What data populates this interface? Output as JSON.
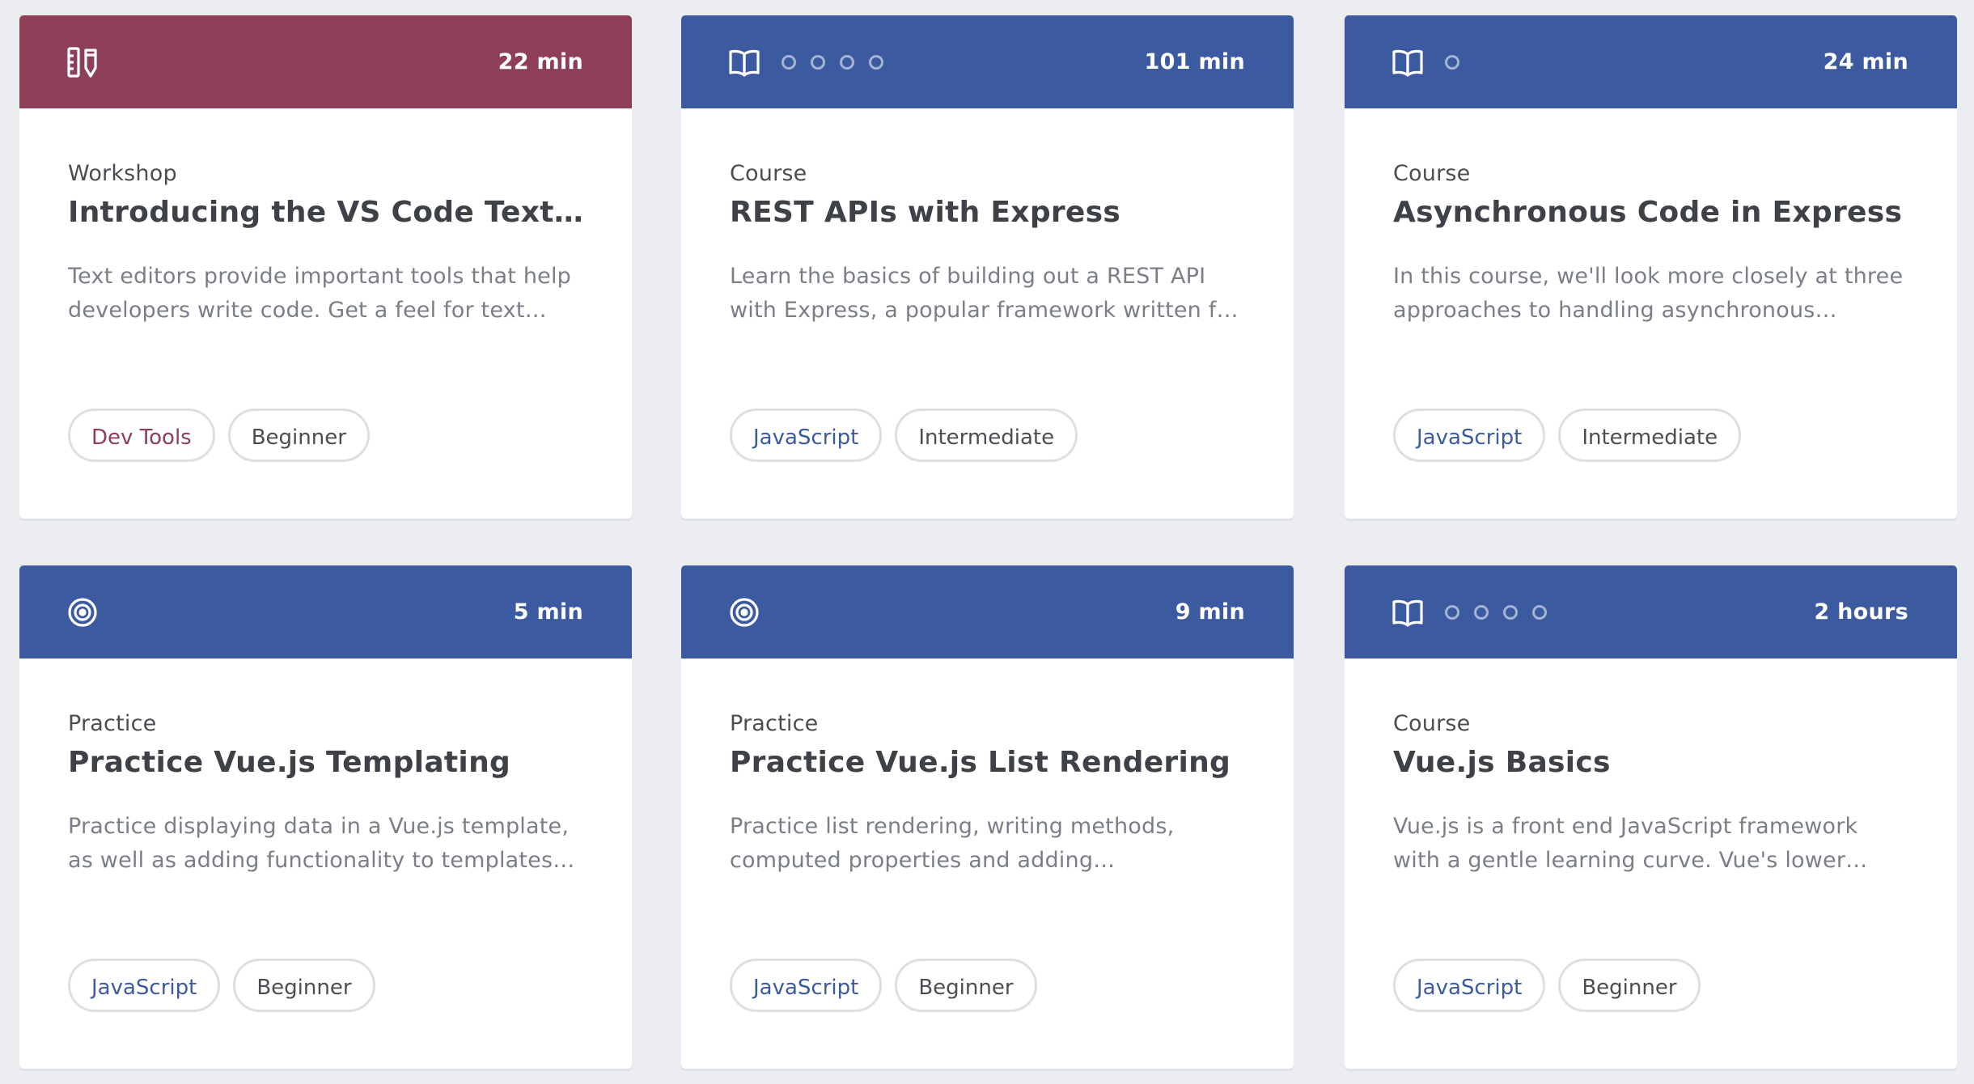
{
  "colors": {
    "workshop_header": "#8e3f58",
    "course_header": "#3b5aa0",
    "practice_header": "#3b5aa0",
    "devtools_tag_text": "#8e3f58",
    "javascript_tag_text": "#3b5aa0",
    "page_background": "#ebedf0"
  },
  "cards": [
    {
      "icon": "tools-icon",
      "duration": "22 min",
      "kind": "Workshop",
      "title": "Introducing the VS Code Text Edi...",
      "description": "Text editors provide important tools that help developers write code. Get a feel for text…",
      "dots": 0,
      "tags": [
        {
          "label": "Dev Tools",
          "color": "#8e3f58"
        },
        {
          "label": "Beginner",
          "color": "#4b4d52"
        }
      ]
    },
    {
      "icon": "book-icon",
      "duration": "101 min",
      "kind": "Course",
      "title": "REST APIs with Express",
      "description": "Learn the basics of building out a REST API with Express, a popular framework written f…",
      "dots": 4,
      "tags": [
        {
          "label": "JavaScript",
          "color": "#3b5aa0"
        },
        {
          "label": "Intermediate",
          "color": "#4b4d52"
        }
      ]
    },
    {
      "icon": "book-icon",
      "duration": "24 min",
      "kind": "Course",
      "title": "Asynchronous Code in Express",
      "description": "In this course, we'll look more closely at three approaches to handling asynchronous…",
      "dots": 1,
      "tags": [
        {
          "label": "JavaScript",
          "color": "#3b5aa0"
        },
        {
          "label": "Intermediate",
          "color": "#4b4d52"
        }
      ]
    },
    {
      "icon": "target-icon",
      "duration": "5 min",
      "kind": "Practice",
      "title": "Practice Vue.js Templating",
      "description": "Practice displaying data in a Vue.js template, as well as adding functionality to templates…",
      "dots": 0,
      "tags": [
        {
          "label": "JavaScript",
          "color": "#3b5aa0"
        },
        {
          "label": "Beginner",
          "color": "#4b4d52"
        }
      ]
    },
    {
      "icon": "target-icon",
      "duration": "9 min",
      "kind": "Practice",
      "title": "Practice Vue.js List Rendering",
      "description": "Practice list rendering, writing methods, computed properties and adding…",
      "dots": 0,
      "tags": [
        {
          "label": "JavaScript",
          "color": "#3b5aa0"
        },
        {
          "label": "Beginner",
          "color": "#4b4d52"
        }
      ]
    },
    {
      "icon": "book-icon",
      "duration": "2 hours",
      "kind": "Course",
      "title": "Vue.js Basics",
      "description": "Vue.js is a front end JavaScript framework with a gentle learning curve. Vue's lower…",
      "dots": 4,
      "tags": [
        {
          "label": "JavaScript",
          "color": "#3b5aa0"
        },
        {
          "label": "Beginner",
          "color": "#4b4d52"
        }
      ]
    }
  ]
}
